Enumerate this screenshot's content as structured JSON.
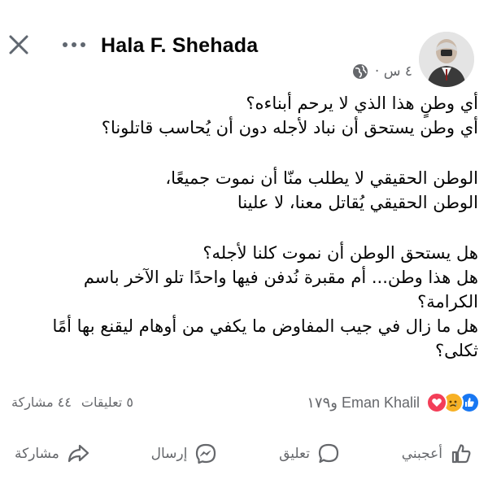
{
  "header": {
    "author": "Hala F. Shehada",
    "time": "٤ س ·",
    "close_icon": "close-icon",
    "more_icon": "more-icon",
    "privacy_icon": "globe-icon"
  },
  "post": {
    "paragraphs": [
      [
        "أي وطنٍ هذا الذي لا يرحم أبناءه؟",
        "أي وطن يستحق أن نباد لأجله دون أن يُحاسب قاتلونا؟"
      ],
      [
        "الوطن الحقيقي لا يطلب منّا أن نموت جميعًا،",
        "الوطن الحقيقي يُقاتل معنا، لا علينا"
      ],
      [
        "هل يستحق الوطن أن نموت كلنا لأجله؟",
        "هل هذا وطن... أم مقبرة نُدفن فيها واحدًا تلو الآخر باسم الكرامة؟",
        "هل ما زال في جيب المفاوض ما يكفي من أوهام ليقنع بها أمًا ثكلى؟"
      ]
    ]
  },
  "engagement": {
    "reaction_text": "Eman Khalil و١٧٩",
    "comments": "٥ تعليقات",
    "shares": "٤٤ مشاركة",
    "reaction_icons": [
      "like-icon",
      "sad-icon",
      "love-icon"
    ],
    "colors": {
      "like": "#1877f2",
      "sad": "#f7b125",
      "love": "#f33e58",
      "muted": "#65676b"
    }
  },
  "actions": {
    "like": "أعجبني",
    "comment": "تعليق",
    "send": "إرسال",
    "share": "مشاركة"
  }
}
